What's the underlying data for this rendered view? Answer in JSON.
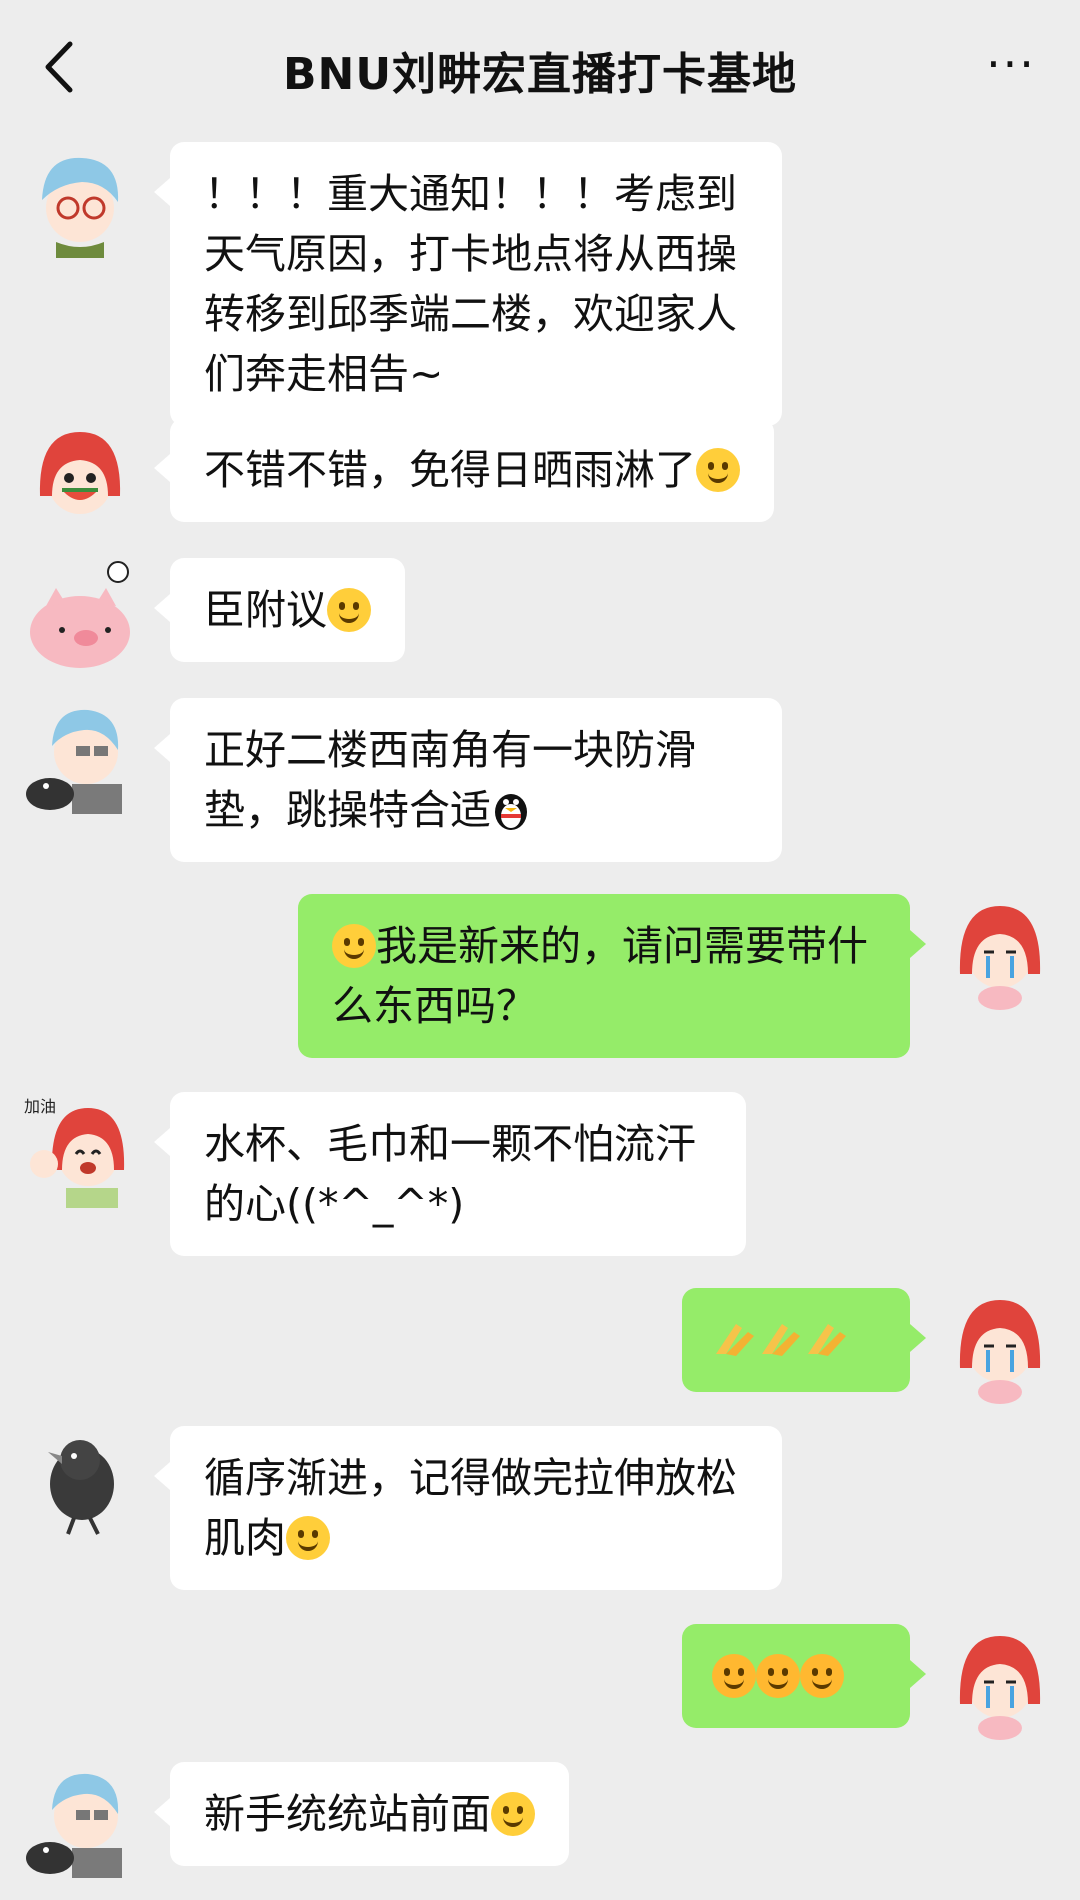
{
  "header": {
    "title": "BNU刘畊宏直播打卡基地",
    "more_label": "···"
  },
  "messages": [
    {
      "side": "left",
      "avatar": "blue-hair-glasses",
      "text": "！！！重大通知！！！考虑到天气原因，打卡地点将从西操转移到邱季端二楼，欢迎家人们奔走相告~"
    },
    {
      "side": "left",
      "avatar": "red-hair-watermelon",
      "text": "不错不错，免得日晒雨淋了",
      "emoji": "grin"
    },
    {
      "side": "left",
      "avatar": "pink-pig",
      "text": "臣附议",
      "emoji": "ok-hand-face"
    },
    {
      "side": "left",
      "avatar": "old-man-with-bird",
      "text": "正好二楼西南角有一块防滑垫，跳操特合适",
      "emoji": "penguin"
    },
    {
      "side": "right",
      "avatar": "red-hair-crying",
      "text": "我是新来的，请问需要带什么东西吗？",
      "emoji_prefix": "pleading-face"
    },
    {
      "side": "left",
      "avatar": "red-hair-cheering",
      "text": "水杯、毛巾和一颗不怕流汗的心((*^_^*)"
    },
    {
      "side": "right",
      "avatar": "red-hair-crying",
      "text": "",
      "emoji_repeat": "clap-hands",
      "count": 3
    },
    {
      "side": "left",
      "avatar": "black-bird",
      "text": "循序渐进，记得做完拉伸放松肌肉",
      "emoji": "smile"
    },
    {
      "side": "right",
      "avatar": "red-hair-crying",
      "text": "",
      "emoji_repeat": "headband-fist",
      "count": 3
    },
    {
      "side": "left",
      "avatar": "old-man-with-bird",
      "text": "新手统统站前面",
      "emoji": "squint-grin"
    }
  ],
  "colors": {
    "background": "#ededed",
    "bubble_in": "#ffffff",
    "bubble_out": "#95ec69"
  }
}
